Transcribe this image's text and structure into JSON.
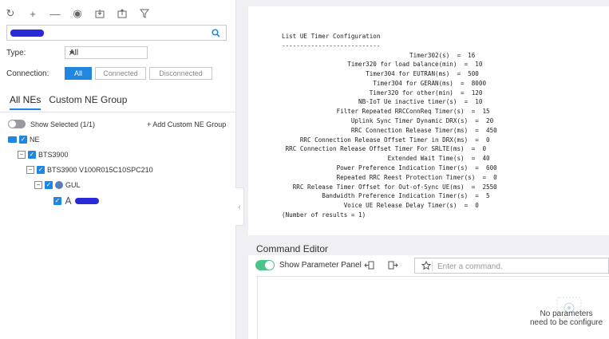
{
  "toolbar": {
    "icons": [
      "refresh-icon",
      "add-icon",
      "remove-icon",
      "view-icon",
      "import-icon",
      "export-icon",
      "filter-icon"
    ]
  },
  "search": {
    "value": ""
  },
  "filters": {
    "type_label": "Type:",
    "type_value": "All",
    "connection_label": "Connection:",
    "connection_options": [
      "All",
      "Connected",
      "Disconnected"
    ],
    "connection_selected": "All"
  },
  "tabs": [
    "All NEs",
    "Custom NE Group"
  ],
  "tree": {
    "show_selected": "Show Selected (1/1)",
    "add_group": "+ Add Custom NE Group",
    "nodes": [
      {
        "label": "NE",
        "level": 0
      },
      {
        "label": "BTS3900",
        "level": 1
      },
      {
        "label": "BTS3900 V100R015C10SPC210",
        "level": 2
      },
      {
        "label": "GUL",
        "level": 3
      }
    ]
  },
  "output": {
    "text": "List UE Timer Configuration\n---------------------------\n                                   Timer302(s)  =  16\n                  Timer320 for load balance(min)  =  10\n                       Timer304 for EUTRAN(ms)  =  500\n                         Timer304 for GERAN(ms)  =  8000\n                        Timer320 for other(min)  =  120\n                     NB-IoT Ue inactive timer(s)  =  10\n               Filter Repeated RRCConnReq Timer(s)  =  15\n                   Uplink Sync Timer Dynamic DRX(s)  =  20\n                   RRC Connection Release Timer(ms)  =  450\n     RRC Connection Release Offset Timer in DRX(ms)  =  0\n RRC Connection Release Offset Timer For SRLTE(ms)  =  0\n                             Extended Wait Time(s)  =  40\n               Power Preference Indication Timer(s)  =  600\n               Repeated RRC Reest Protection Timer(s)  =  0\n   RRC Release Timer Offset for Out-of-Sync UE(ms)  =  2550\n           Bandwidth Preference Indication Timer(s)  =  5\n                 Voice UE Release Delay Timer(s)  =  0\n(Number of results = 1)"
  },
  "command_editor": {
    "title": "Command Editor",
    "show_parameter_panel": "Show Parameter Panel",
    "input_placeholder": "Enter a command.",
    "no_params_line1": "No parameters",
    "no_params_line2": "need to be configure"
  },
  "colors": {
    "accent": "#1f87e0",
    "toggle_on": "#4cc38a"
  }
}
